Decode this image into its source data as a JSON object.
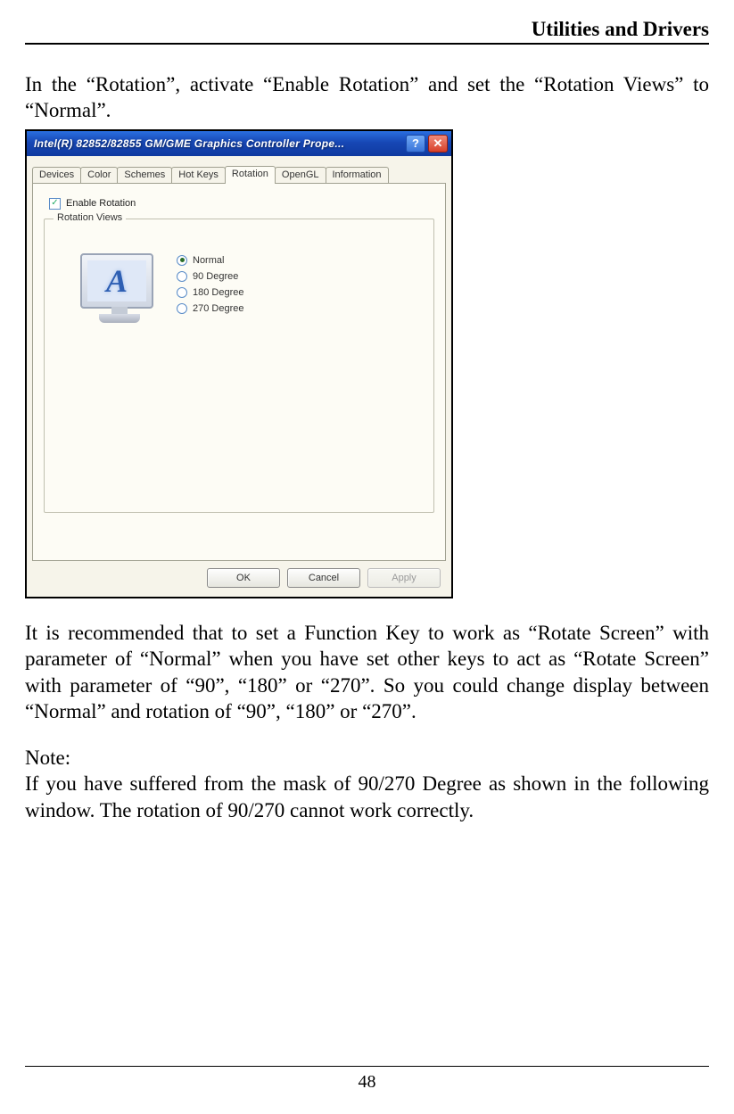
{
  "header": {
    "title": "Utilities and Drivers"
  },
  "intro": "In the “Rotation”, activate “Enable Rotation” and set the “Rotation Views” to “Normal”.",
  "dialog": {
    "title": "Intel(R) 82852/82855 GM/GME Graphics Controller Prope...",
    "help_glyph": "?",
    "close_glyph": "✕",
    "tabs": [
      "Devices",
      "Color",
      "Schemes",
      "Hot Keys",
      "Rotation",
      "OpenGL",
      "Information"
    ],
    "active_tab": "Rotation",
    "enable_rotation": {
      "label": "Enable Rotation",
      "checked": true
    },
    "group_legend": "Rotation Views",
    "monitor_letter": "A",
    "radios": [
      {
        "label": "Normal",
        "selected": true
      },
      {
        "label": "90 Degree",
        "selected": false
      },
      {
        "label": "180 Degree",
        "selected": false
      },
      {
        "label": "270 Degree",
        "selected": false
      }
    ],
    "buttons": {
      "ok": "OK",
      "cancel": "Cancel",
      "apply": "Apply"
    }
  },
  "para2": "It is recommended that to set a Function Key to work as “Rotate Screen” with parameter of “Normal” when you have set other keys to act as “Rotate Screen” with parameter of “90”, “180” or “270”. So you could change display between “Normal” and rotation of “90”, “180” or “270”.",
  "note_label": "Note:",
  "note_body": "If you have suffered from the mask of 90/270 Degree as shown in the following window. The rotation of 90/270 cannot work correctly.",
  "page_number": "48"
}
